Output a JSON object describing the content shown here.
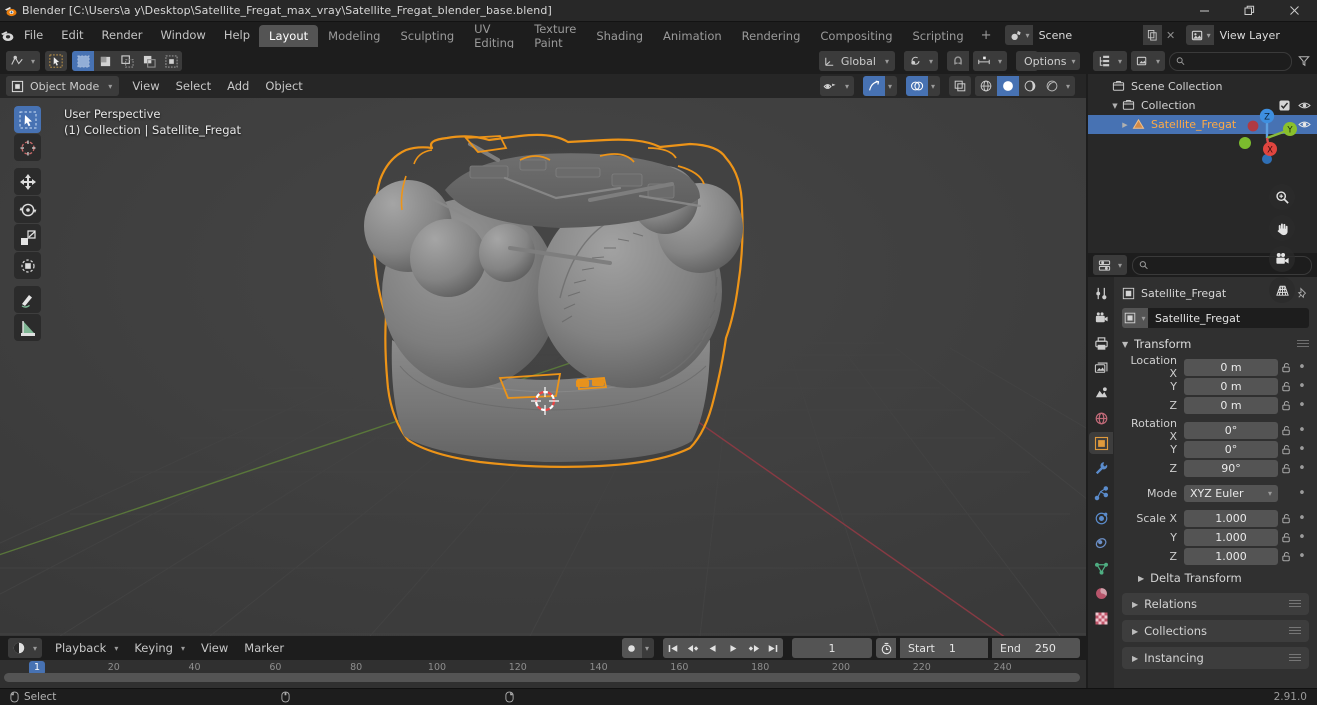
{
  "window": {
    "title": "Blender [C:\\Users\\a y\\Desktop\\Satellite_Fregat_max_vray\\Satellite_Fregat_blender_base.blend]",
    "minimize": "—",
    "maximize": "❐",
    "close": "✕"
  },
  "topbar": {
    "menus": [
      "File",
      "Edit",
      "Render",
      "Window",
      "Help"
    ],
    "workspaces": [
      {
        "label": "Layout",
        "active": true
      },
      {
        "label": "Modeling",
        "active": false
      },
      {
        "label": "Sculpting",
        "active": false
      },
      {
        "label": "UV Editing",
        "active": false
      },
      {
        "label": "Texture Paint",
        "active": false
      },
      {
        "label": "Shading",
        "active": false
      },
      {
        "label": "Animation",
        "active": false
      },
      {
        "label": "Rendering",
        "active": false
      },
      {
        "label": "Compositing",
        "active": false
      },
      {
        "label": "Scripting",
        "active": false
      }
    ],
    "add_workspace": "+",
    "scene_name": "Scene",
    "view_layer_name": "View Layer"
  },
  "viewport_header": {
    "editor_type": "editor-type-icon",
    "mode": "Object Mode",
    "menus": [
      "View",
      "Select",
      "Add",
      "Object"
    ],
    "transform_orientation": "Global",
    "options_label": "Options",
    "shading_modes": [
      "wireframe",
      "solid",
      "material-preview",
      "rendered"
    ],
    "active_shading": "solid"
  },
  "viewport": {
    "overlay_line1": "User Perspective",
    "overlay_line2": "(1) Collection | Satellite_Fregat",
    "gizmo_axes": {
      "x": "X",
      "y": "Y",
      "z": "Z"
    },
    "tools": [
      {
        "name": "tweak-select-box-tool",
        "active": true
      },
      {
        "name": "cursor-tool",
        "active": false
      },
      {
        "name": "move-tool",
        "active": false
      },
      {
        "name": "rotate-tool",
        "active": false
      },
      {
        "name": "scale-tool",
        "active": false
      },
      {
        "name": "transform-tool",
        "active": false
      },
      {
        "name": "annotate-tool",
        "active": false
      },
      {
        "name": "measure-tool",
        "active": false
      }
    ],
    "nav_buttons": [
      "zoom-icon",
      "pan-hand-icon",
      "camera-icon",
      "perspective-grid-icon"
    ]
  },
  "outliner": {
    "search_placeholder": "",
    "rows": [
      {
        "label": "Scene Collection",
        "icon": "collection-icon",
        "indent": 0,
        "selected": false,
        "has_disclosure": false,
        "checkbox": false,
        "eye": false
      },
      {
        "label": "Collection",
        "icon": "collection-icon",
        "indent": 1,
        "selected": false,
        "has_disclosure": true,
        "checkbox": true,
        "eye": true
      },
      {
        "label": "Satellite_Fregat",
        "icon": "mesh-data-icon",
        "indent": 2,
        "selected": true,
        "has_disclosure": true,
        "checkbox": false,
        "eye": true
      }
    ]
  },
  "properties": {
    "breadcrumb_object": "Satellite_Fregat",
    "object_name_value": "Satellite_Fregat",
    "tabs": [
      {
        "name": "tool-tab",
        "active": false
      },
      {
        "name": "render-tab",
        "active": false
      },
      {
        "name": "output-tab",
        "active": false
      },
      {
        "name": "view-layer-tab",
        "active": false
      },
      {
        "name": "scene-tab",
        "active": false
      },
      {
        "name": "world-tab",
        "active": false
      },
      {
        "name": "object-tab",
        "active": true
      },
      {
        "name": "modifier-tab",
        "active": false
      },
      {
        "name": "particles-tab",
        "active": false
      },
      {
        "name": "physics-tab",
        "active": false
      },
      {
        "name": "constraints-tab",
        "active": false
      },
      {
        "name": "object-data-tab",
        "active": false
      },
      {
        "name": "material-tab",
        "active": false
      },
      {
        "name": "texture-tab",
        "active": false
      }
    ],
    "transform": {
      "title": "Transform",
      "location": {
        "label": "Location X",
        "x": "0 m",
        "y": "0 m",
        "z": "0 m",
        "y_label": "Y",
        "z_label": "Z"
      },
      "rotation": {
        "label": "Rotation X",
        "x": "0°",
        "y": "0°",
        "z": "90°",
        "y_label": "Y",
        "z_label": "Z"
      },
      "mode": {
        "label": "Mode",
        "value": "XYZ Euler"
      },
      "scale": {
        "label": "Scale X",
        "x": "1.000",
        "y": "1.000",
        "z": "1.000",
        "y_label": "Y",
        "z_label": "Z"
      },
      "delta": "Delta Transform"
    },
    "panels": [
      "Relations",
      "Collections",
      "Instancing"
    ]
  },
  "timeline": {
    "editor_icon": "timeline-editor-icon",
    "menus": [
      "Playback",
      "Keying",
      "View",
      "Marker"
    ],
    "current_frame": "1",
    "start_label": "Start",
    "start_value": "1",
    "end_label": "End",
    "end_value": "250",
    "ticks": [
      "20",
      "40",
      "60",
      "80",
      "100",
      "120",
      "140",
      "160",
      "180",
      "200",
      "220",
      "240"
    ],
    "playhead_frame": "1"
  },
  "status": {
    "mouse_action": "Select",
    "version": "2.91.0"
  },
  "colors": {
    "accent_blue": "#4772b3",
    "select_orange": "#ed9418",
    "panel_bg": "#303030",
    "header_bg": "#1d1d1d",
    "viewport_bg": "#3b3b3b",
    "field_bg": "#545454"
  }
}
